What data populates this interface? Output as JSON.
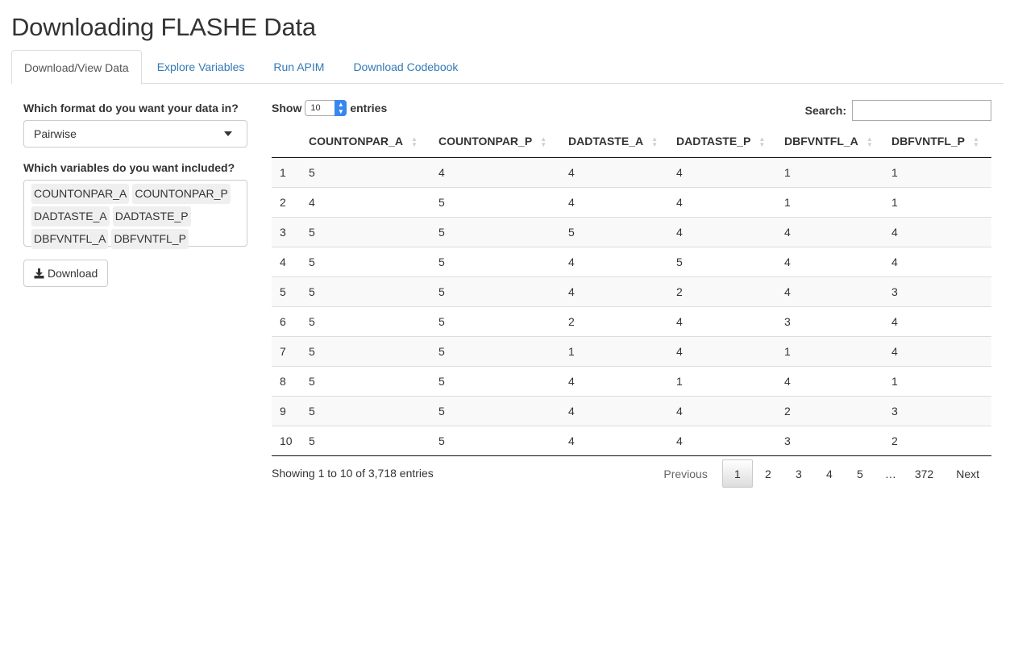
{
  "app": {
    "title": "Downloading FLASHE Data"
  },
  "tabs": [
    "Download/View Data",
    "Explore Variables",
    "Run APIM",
    "Download Codebook"
  ],
  "sidebar": {
    "format_label": "Which format do you want your data in?",
    "format_value": "Pairwise",
    "variables_label": "Which variables do you want included?",
    "variables": [
      "COUNTONPAR_A",
      "COUNTONPAR_P",
      "DADTASTE_A",
      "DADTASTE_P",
      "DBFVNTFL_A",
      "DBFVNTFL_P"
    ],
    "download_label": "Download"
  },
  "table_controls": {
    "show_label": "Show",
    "entries_value": "10",
    "entries_label": "entries",
    "search_label": "Search:"
  },
  "table": {
    "columns": [
      "",
      "COUNTONPAR_A",
      "COUNTONPAR_P",
      "DADTASTE_A",
      "DADTASTE_P",
      "DBFVNTFL_A",
      "DBFVNTFL_P"
    ],
    "rows": [
      [
        "1",
        "5",
        "4",
        "4",
        "4",
        "1",
        "1"
      ],
      [
        "2",
        "4",
        "5",
        "4",
        "4",
        "1",
        "1"
      ],
      [
        "3",
        "5",
        "5",
        "5",
        "4",
        "4",
        "4"
      ],
      [
        "4",
        "5",
        "5",
        "4",
        "5",
        "4",
        "4"
      ],
      [
        "5",
        "5",
        "5",
        "4",
        "2",
        "4",
        "3"
      ],
      [
        "6",
        "5",
        "5",
        "2",
        "4",
        "3",
        "4"
      ],
      [
        "7",
        "5",
        "5",
        "1",
        "4",
        "1",
        "4"
      ],
      [
        "8",
        "5",
        "5",
        "4",
        "1",
        "4",
        "1"
      ],
      [
        "9",
        "5",
        "5",
        "4",
        "4",
        "2",
        "3"
      ],
      [
        "10",
        "5",
        "5",
        "4",
        "4",
        "3",
        "2"
      ]
    ]
  },
  "info_text": "Showing 1 to 10 of 3,718 entries",
  "pagination": {
    "previous": "Previous",
    "pages": [
      "1",
      "2",
      "3",
      "4",
      "5",
      "…",
      "372"
    ],
    "current": "1",
    "next": "Next"
  }
}
